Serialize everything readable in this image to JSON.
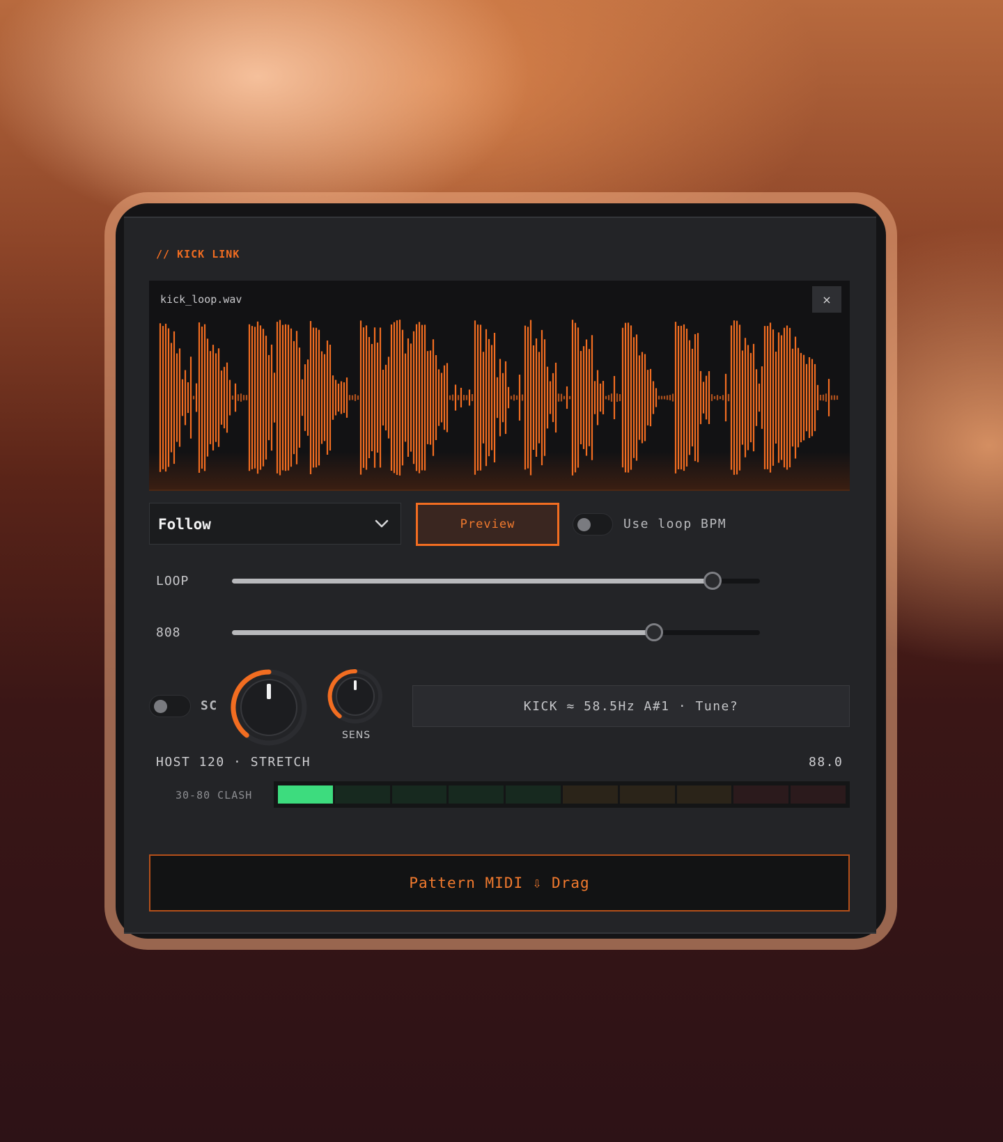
{
  "app": {
    "title": "// KICK LINK"
  },
  "waveform": {
    "filename": "kick_loop.wav",
    "close_label": "×",
    "color": "#f26d21"
  },
  "controls": {
    "mode_select": {
      "value": "Follow"
    },
    "preview_label": "Preview",
    "loop_bpm_toggle": {
      "label": "Use loop BPM",
      "on": false
    }
  },
  "sliders": [
    {
      "label": "LOOP",
      "value": 0.91
    },
    {
      "label": "808",
      "value": 0.8
    }
  ],
  "sidechain": {
    "label": "SC",
    "on": false
  },
  "knobs": [
    {
      "label": "",
      "value": 0.5
    },
    {
      "label": "SENS",
      "value": 0.5
    }
  ],
  "tune_readout": "KICK ≈ 58.5Hz A#1 · Tune?",
  "host": {
    "text": "HOST 120 · STRETCH",
    "value": "88.0"
  },
  "clash_meter": {
    "label": "30-80 CLASH",
    "segments": [
      "#3ddc7e",
      "#17291f",
      "#17291f",
      "#17291f",
      "#17291f",
      "#2b2419",
      "#2b2419",
      "#2b2419",
      "#2b1a1c",
      "#2b1a1c"
    ],
    "level": 0.1
  },
  "drag_label": "Pattern MIDI ⇩ Drag",
  "colors": {
    "accent": "#f26d21",
    "meter_active": "#3ddc7e"
  }
}
